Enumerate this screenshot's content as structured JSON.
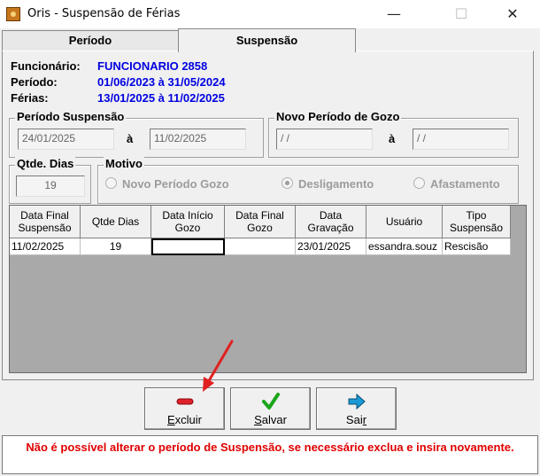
{
  "window": {
    "title": "Oris - Suspensão de Férias",
    "minimize_glyph": "—",
    "maximize_glyph": "☐",
    "close_glyph": "✕"
  },
  "tabs": [
    {
      "label": "Período",
      "active": false
    },
    {
      "label": "Suspensão",
      "active": true
    }
  ],
  "info": {
    "funcionario_label": "Funcionário:",
    "funcionario_value": "FUNCIONARIO 2858",
    "periodo_label": "Período:",
    "periodo_value": "01/06/2023 à 31/05/2024",
    "ferias_label": "Férias:",
    "ferias_value": "13/01/2025 à 11/02/2025"
  },
  "periodo_suspensao": {
    "title": "Período Suspensão",
    "inicio": "24/01/2025",
    "separator": "à",
    "fim": "11/02/2025"
  },
  "novo_periodo_gozo": {
    "title": "Novo Período de Gozo",
    "inicio": " / /",
    "separator": "à",
    "fim": " / /"
  },
  "qtde_dias": {
    "title": "Qtde. Dias",
    "value": "19"
  },
  "motivo": {
    "title": "Motivo",
    "options": [
      {
        "label": "Novo Período Gozo",
        "checked": false
      },
      {
        "label": "Desligamento",
        "checked": true
      },
      {
        "label": "Afastamento",
        "checked": false
      }
    ]
  },
  "table": {
    "headers": [
      "Data Final Suspensão",
      "Qtde Dias",
      "Data Início Gozo",
      "Data Final Gozo",
      "Data Gravação",
      "Usuário",
      "Tipo Suspensão"
    ],
    "header_lines": [
      [
        "Data Final",
        "Suspensão"
      ],
      [
        "Qtde Dias"
      ],
      [
        "Data Início",
        "Gozo"
      ],
      [
        "Data Final",
        "Gozo"
      ],
      [
        "Data",
        "Gravação"
      ],
      [
        "Usuário"
      ],
      [
        "Tipo",
        "Suspensão"
      ]
    ],
    "rows": [
      [
        "11/02/2025",
        "19",
        "",
        "",
        "23/01/2025",
        "essandra.souz",
        "Rescisão"
      ]
    ]
  },
  "buttons": {
    "excluir_first": "E",
    "excluir_rest": "xcluir",
    "salvar_first": "S",
    "salvar_rest": "alvar",
    "sair_first": "Sai",
    "sair_rest": "r"
  },
  "message": "Não é possível alterar o período de Suspensão, se necessário exclua e insira novamente.",
  "colors": {
    "value_blue": "#0000e0",
    "message_red": "#e00000",
    "annotation_arrow": "#e02020",
    "excluir_icon": "#e0202a",
    "salvar_icon": "#1aa61a",
    "sair_icon": "#1a9ad6"
  },
  "icons": {
    "excluir": "minus-icon",
    "salvar": "checkmark-icon",
    "sair": "arrow-right-icon"
  }
}
